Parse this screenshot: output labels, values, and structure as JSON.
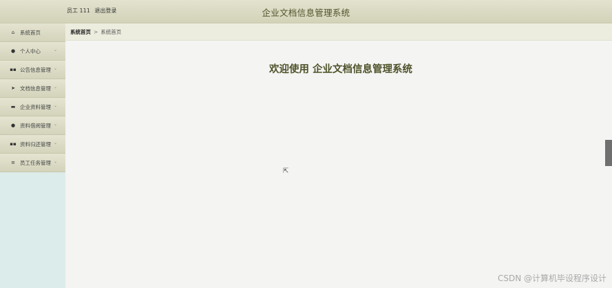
{
  "header": {
    "user_label": "员工 111",
    "logout_label": "退出登录",
    "title": "企业文档信息管理系统"
  },
  "sidebar": {
    "items": [
      {
        "label": "系统首页",
        "icon": "home-icon",
        "glyph": "⌂",
        "has_chevron": false
      },
      {
        "label": "个人中心",
        "icon": "user-icon",
        "glyph": "●",
        "has_chevron": true
      },
      {
        "label": "公告信息管理",
        "icon": "grid-icon",
        "glyph": "▪▪",
        "has_chevron": true
      },
      {
        "label": "文档信息管理",
        "icon": "send-icon",
        "glyph": "➤",
        "has_chevron": true
      },
      {
        "label": "企业资料管理",
        "icon": "folder-icon",
        "glyph": "▬",
        "has_chevron": true
      },
      {
        "label": "资料借阅管理",
        "icon": "user-icon",
        "glyph": "●",
        "has_chevron": true
      },
      {
        "label": "资料归还管理",
        "icon": "grid-icon",
        "glyph": "▪▪",
        "has_chevron": true
      },
      {
        "label": "员工任务管理",
        "icon": "list-icon",
        "glyph": "≡",
        "has_chevron": true
      }
    ],
    "chevron_glyph": "⌄"
  },
  "breadcrumb": {
    "home": "系统首页",
    "separator": ">",
    "current": "系统首页"
  },
  "main": {
    "welcome": "欢迎使用 企业文档信息管理系统"
  },
  "watermark": "CSDN @计算机毕设程序设计",
  "colors": {
    "accent": "#4e5228",
    "sidebar_bg": "#dcecea",
    "nav_bg": "#dcdcc6"
  }
}
